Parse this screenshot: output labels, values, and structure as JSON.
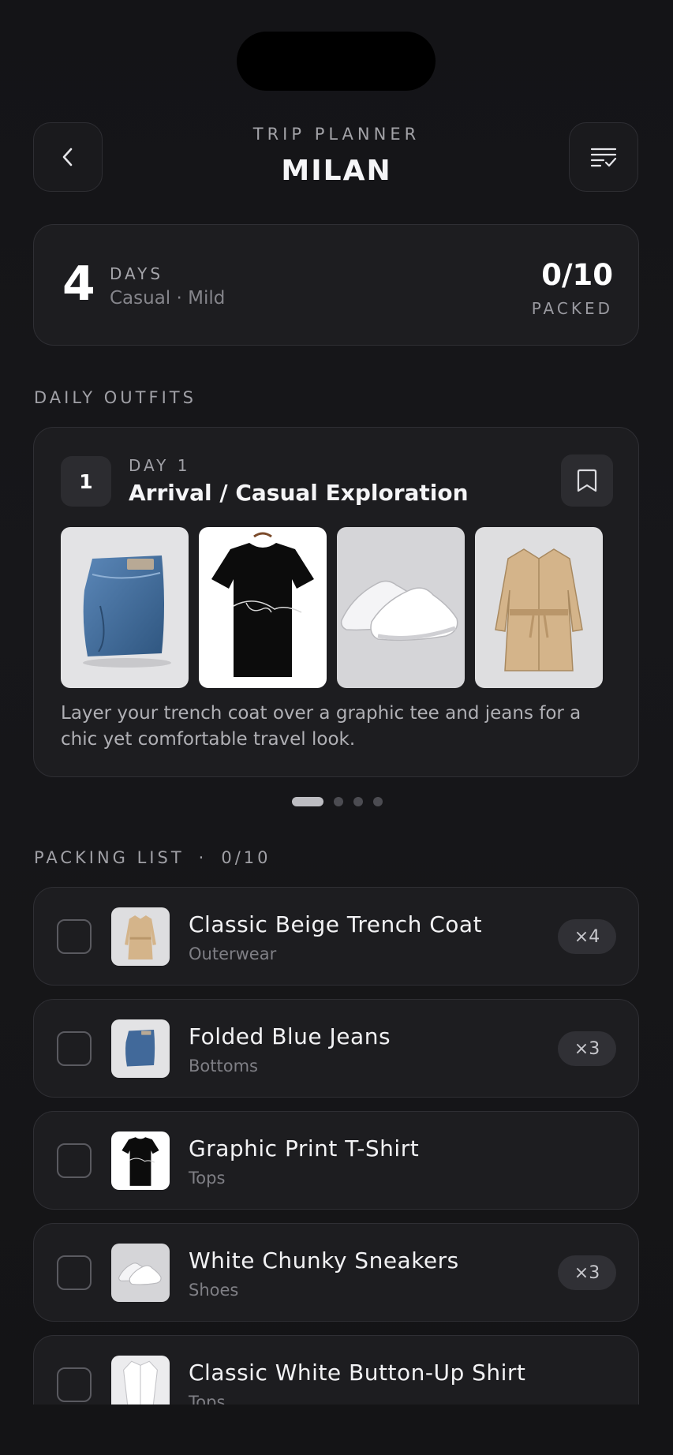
{
  "header": {
    "subtitle": "TRIP PLANNER",
    "title": "MILAN",
    "back_icon": "chevron-left-icon",
    "list_icon": "checklist-icon"
  },
  "summary": {
    "days_count": "4",
    "days_label": "DAYS",
    "meta": "Casual · Mild",
    "packed": "0/10",
    "packed_label": "PACKED"
  },
  "outfits_section": {
    "label": "DAILY OUTFITS"
  },
  "outfit": {
    "day_number": "1",
    "day_label": "DAY 1",
    "title": "Arrival / Casual Exploration",
    "bookmark_icon": "bookmark-icon",
    "items": [
      "jeans",
      "graphic-tee",
      "white-sneakers",
      "trench-coat"
    ],
    "description": "Layer your trench coat over a graphic tee and jeans for a chic yet comfortable travel look."
  },
  "pager": {
    "pages": 4,
    "active": 0
  },
  "packing": {
    "label": "PACKING LIST",
    "separator": "·",
    "count": "0/10",
    "items": [
      {
        "name": "Classic Beige Trench Coat",
        "category": "Outerwear",
        "qty": "×4",
        "thumb": "trench-coat",
        "checked": false
      },
      {
        "name": "Folded Blue Jeans",
        "category": "Bottoms",
        "qty": "×3",
        "thumb": "jeans",
        "checked": false
      },
      {
        "name": "Graphic Print T-Shirt",
        "category": "Tops",
        "qty": "",
        "thumb": "graphic-tee",
        "checked": false
      },
      {
        "name": "White Chunky Sneakers",
        "category": "Shoes",
        "qty": "×3",
        "thumb": "white-sneakers",
        "checked": false
      },
      {
        "name": "Classic White Button-Up Shirt",
        "category": "Tops",
        "qty": "",
        "thumb": "white-shirt",
        "checked": false
      }
    ]
  },
  "colors": {
    "background": "#141416",
    "card": "#1d1d20",
    "border": "#2f2f34",
    "text": "#f2f2f4",
    "muted": "#85858b"
  }
}
